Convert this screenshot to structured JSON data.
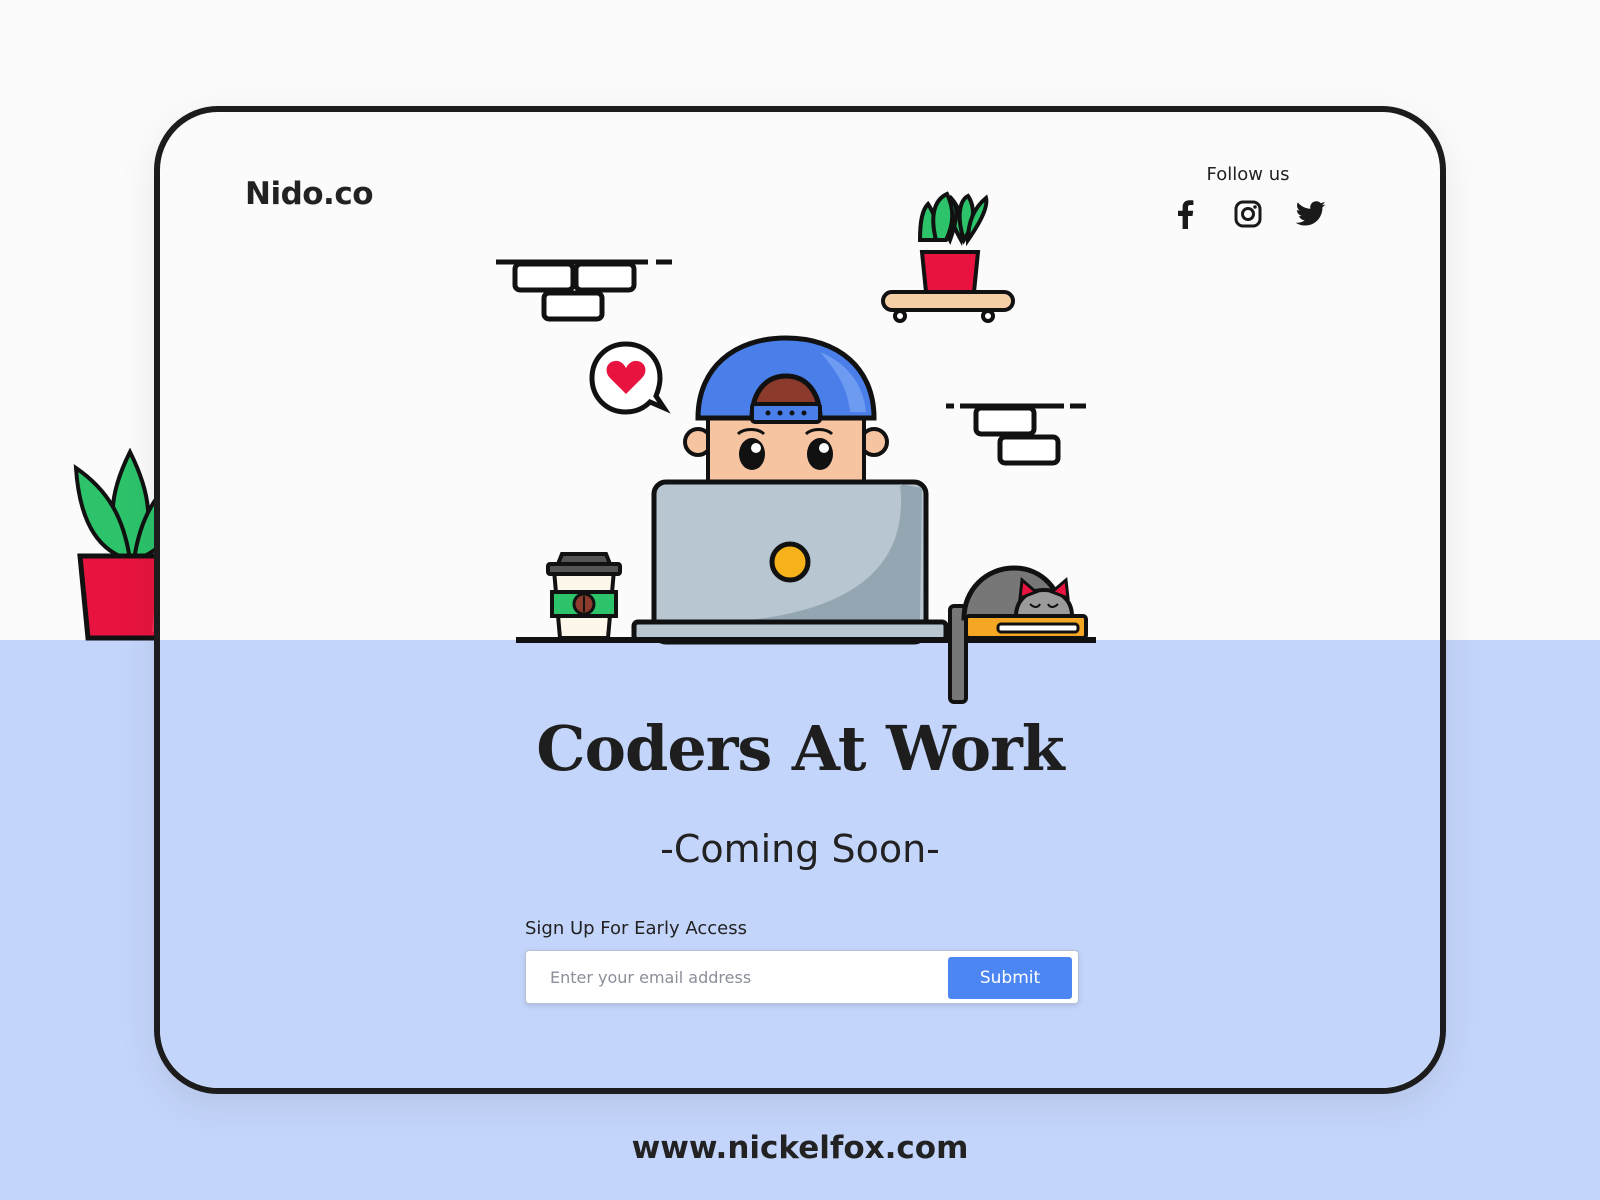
{
  "brand": {
    "logo": "Nido.co"
  },
  "social": {
    "label": "Follow us",
    "links": [
      {
        "name": "facebook",
        "icon": "facebook-icon"
      },
      {
        "name": "instagram",
        "icon": "instagram-icon"
      },
      {
        "name": "twitter",
        "icon": "twitter-icon"
      }
    ]
  },
  "hero": {
    "title": "Coders At Work",
    "subtitle": "-Coming Soon-"
  },
  "signup": {
    "label": "Sign Up For Early Access",
    "email_placeholder": "Enter your email address",
    "email_value": "",
    "submit_label": "Submit"
  },
  "footer": {
    "url": "www.nickelfox.com"
  },
  "colors": {
    "accent": "#4b86f3",
    "band": "#c4d5fb",
    "background": "#fbfbfb",
    "plant_pot": "#e8143f",
    "plant_leaves": "#2cc36b",
    "cap": "#4a7fea",
    "laptop": "#b8c6d2"
  }
}
